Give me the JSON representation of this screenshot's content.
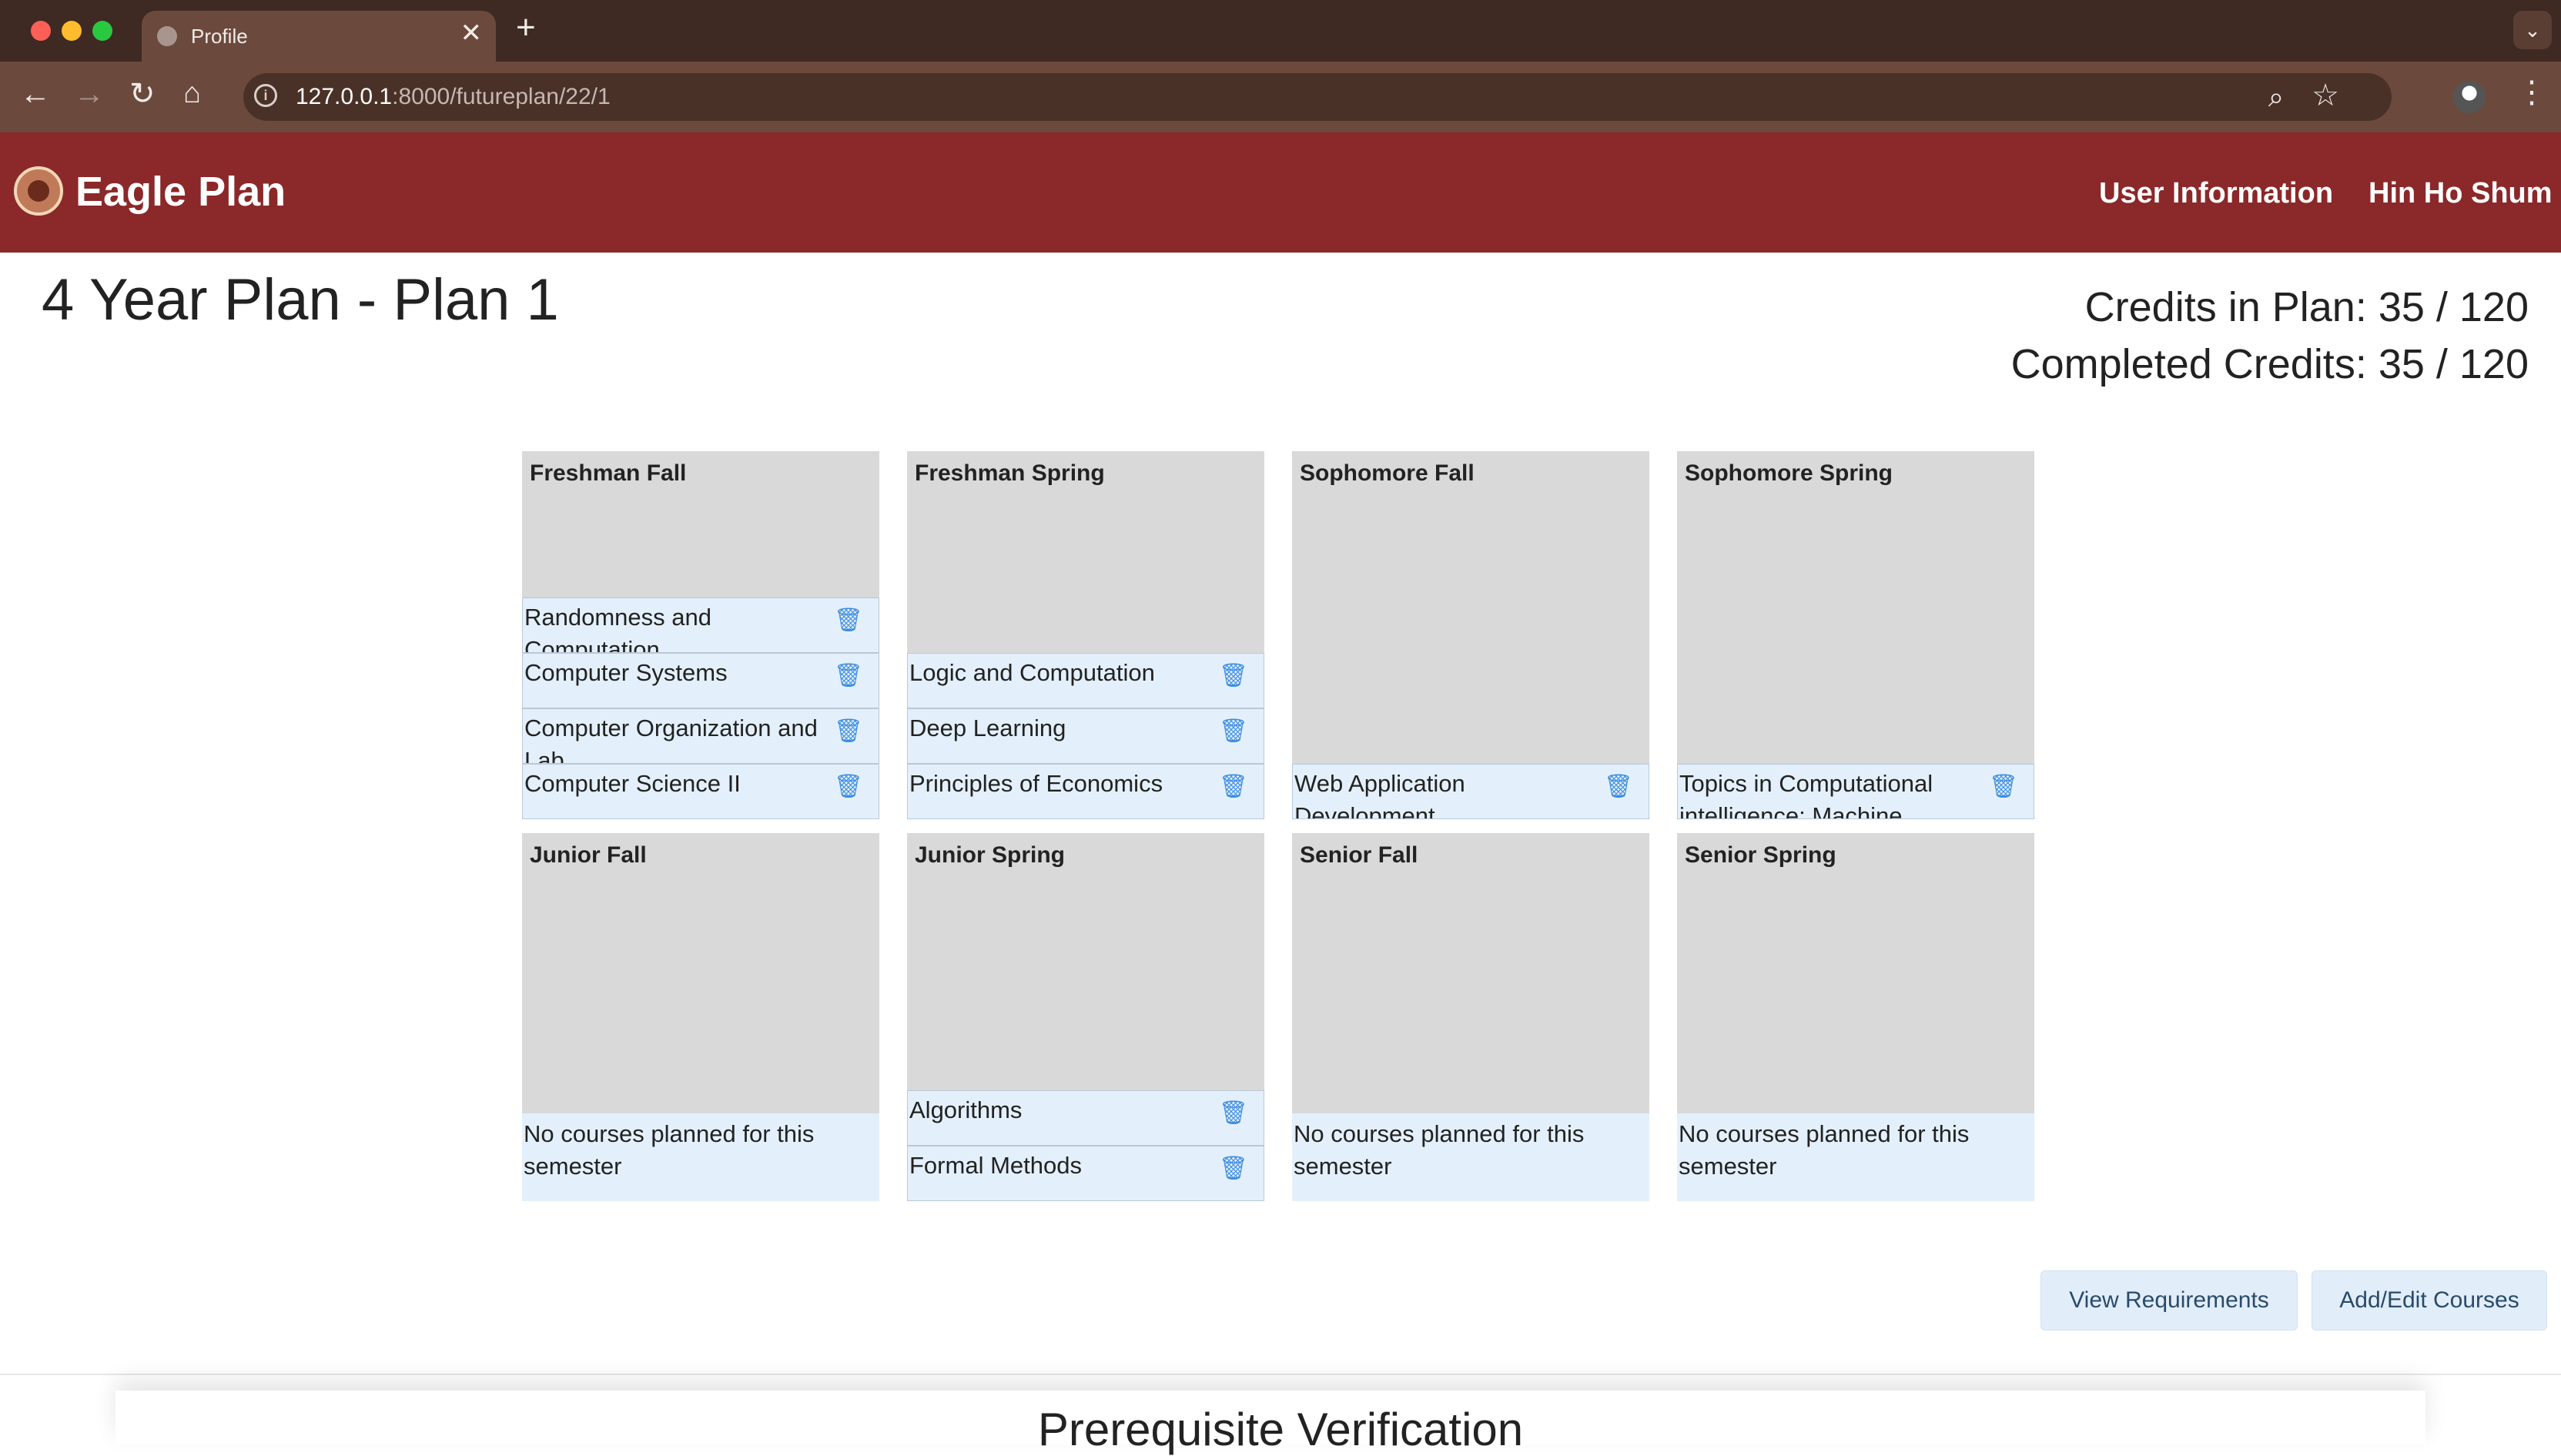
{
  "browser": {
    "tab_title": "Profile",
    "tab_close": "✕",
    "new_tab": "+",
    "tab_menu": "⌄",
    "url_host": "127.0.0.1",
    "url_path": ":8000/futureplan/22/1"
  },
  "header": {
    "brand": "Eagle Plan",
    "nav_user_info": "User Information",
    "nav_user_name": "Hin Ho Shum"
  },
  "page": {
    "title": "4 Year Plan - Plan 1",
    "credits_in_plan": "Credits in Plan: 35 / 120",
    "completed_credits": "Completed Credits: 35 / 120"
  },
  "semesters": [
    {
      "name": "Freshman Fall",
      "courses": [
        "Randomness and Computation",
        "Computer Systems",
        "Computer Organization and Lab",
        "Computer Science II"
      ]
    },
    {
      "name": "Freshman Spring",
      "courses": [
        "Logic and Computation",
        "Deep Learning",
        "Principles of Economics"
      ]
    },
    {
      "name": "Sophomore Fall",
      "courses": [
        "Web Application Development"
      ]
    },
    {
      "name": "Sophomore Spring",
      "courses": [
        "Topics in Computational intelligence: Machine"
      ]
    },
    {
      "name": "Junior Fall",
      "empty_text": "No courses planned for this semester"
    },
    {
      "name": "Junior Spring",
      "courses": [
        "Algorithms",
        "Formal Methods"
      ]
    },
    {
      "name": "Senior Fall",
      "empty_text": "No courses planned for this semester"
    },
    {
      "name": "Senior Spring",
      "empty_text": "No courses planned for this semester"
    }
  ],
  "buttons": {
    "view_requirements": "View Requirements",
    "add_edit_courses": "Add/Edit Courses"
  },
  "section": {
    "title": "Prerequisite Verification"
  },
  "icons": {
    "trash": "trash-icon",
    "trash_color": "#3d8de0",
    "header_color": "#8b2829"
  }
}
